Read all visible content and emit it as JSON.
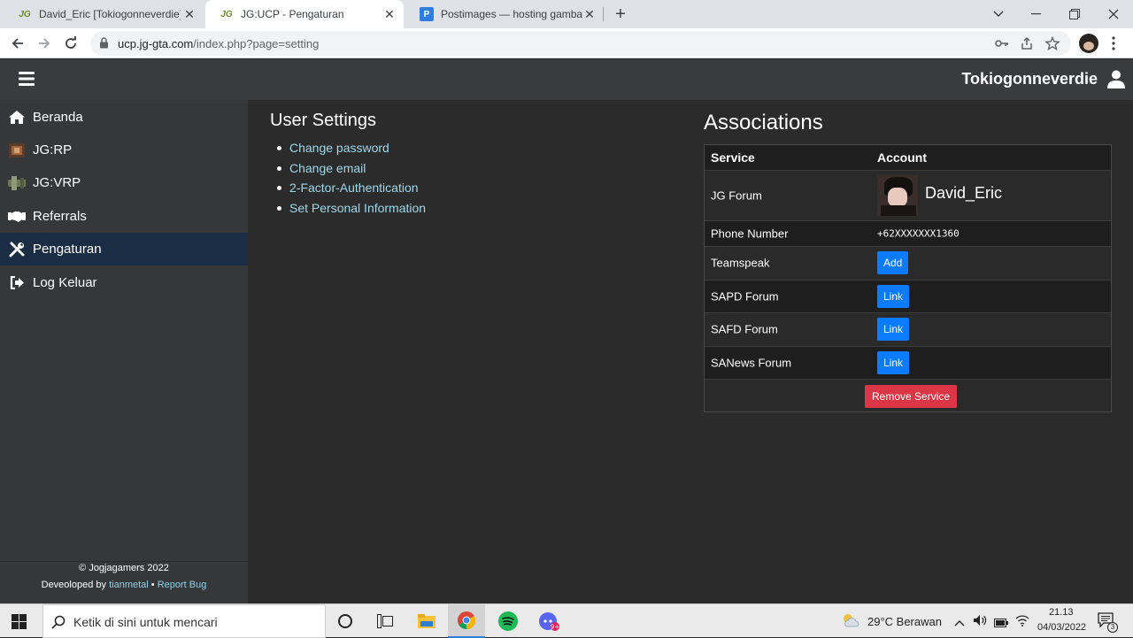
{
  "browser": {
    "tabs": [
      {
        "favicon": "JG",
        "title": "David_Eric [Tokiogonneverdie] - C",
        "active": false
      },
      {
        "favicon": "JG",
        "title": "JG:UCP - Pengaturan",
        "active": true
      },
      {
        "favicon": "P",
        "title": "Postimages — hosting gambar g",
        "active": false
      }
    ],
    "url_host": "ucp.jg-gta.com",
    "url_path": "/index.php?page=setting"
  },
  "header": {
    "username": "Tokiogonneverdie"
  },
  "sidebar": {
    "items": [
      {
        "label": "Beranda",
        "icon": "home-icon",
        "active": false
      },
      {
        "label": "JG:RP",
        "icon": "jgrp-icon",
        "active": false
      },
      {
        "label": "JG:VRP",
        "icon": "jgvrp-icon",
        "active": false
      },
      {
        "label": "Referrals",
        "icon": "handshake-icon",
        "active": false
      },
      {
        "label": "Pengaturan",
        "icon": "tools-icon",
        "active": true
      },
      {
        "label": "Log Keluar",
        "icon": "logout-icon",
        "active": false
      }
    ],
    "footer": {
      "copyright": "© Jogjagamers 2022",
      "developed_prefix": "Deveoloped by",
      "developer": "tianmetal",
      "separator": "•",
      "report": "Report Bug"
    }
  },
  "settings": {
    "title": "User Settings",
    "links": [
      "Change password",
      "Change email",
      "2-Factor-Authentication",
      "Set Personal Information"
    ]
  },
  "associations": {
    "title": "Associations",
    "headers": {
      "service": "Service",
      "account": "Account"
    },
    "jg_forum": {
      "service": "JG Forum",
      "account": "David_Eric"
    },
    "phone": {
      "service": "Phone Number",
      "account": "+62XXXXXXX1360"
    },
    "teamspeak": {
      "service": "Teamspeak",
      "action": "Add"
    },
    "sapd": {
      "service": "SAPD Forum",
      "action": "Link"
    },
    "safd": {
      "service": "SAFD Forum",
      "action": "Link"
    },
    "sanews": {
      "service": "SANews Forum",
      "action": "Link"
    },
    "remove_label": "Remove Service"
  },
  "taskbar": {
    "search_placeholder": "Ketik di sini untuk mencari",
    "weather": "29°C  Berawan",
    "time": "21.13",
    "date": "04/03/2022",
    "notification_count": "3"
  },
  "colors": {
    "accent_blue": "#0d7bff",
    "danger_red": "#dc3545",
    "link_cyan": "#9fd7ea",
    "sidebar_active": "#1b2d44"
  }
}
